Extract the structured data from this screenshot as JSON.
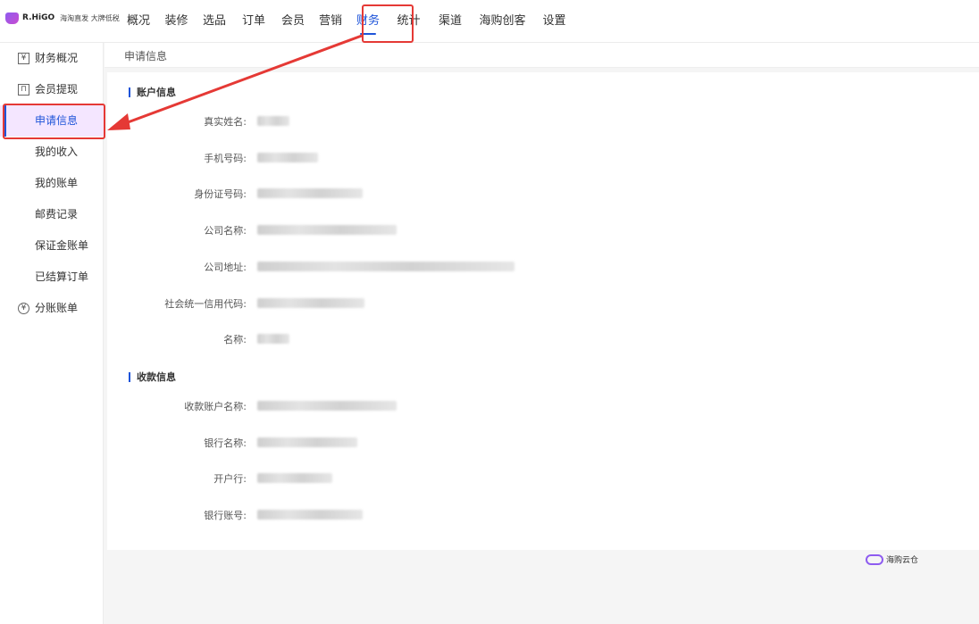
{
  "header": {
    "logo_text": "R.HiGO",
    "logo_subtitle": "海淘直发 大牌低税",
    "nav": [
      "概况",
      "装修",
      "选品",
      "订单",
      "会员",
      "营销",
      "财务",
      "统计",
      "渠道",
      "海购创客",
      "设置"
    ],
    "active_nav": "财务"
  },
  "sidebar": {
    "items": [
      {
        "label": "财务概况",
        "icon": "yen-box-icon",
        "glyph": "¥"
      },
      {
        "label": "会员提现",
        "icon": "wallet-icon",
        "glyph": "⊓"
      },
      {
        "label": "申请信息",
        "active": true
      },
      {
        "label": "我的收入"
      },
      {
        "label": "我的账单"
      },
      {
        "label": "邮费记录"
      },
      {
        "label": "保证金账单"
      },
      {
        "label": "已结算订单"
      },
      {
        "label": "分账账单",
        "icon": "yen-circle-icon",
        "glyph": "¥"
      }
    ]
  },
  "breadcrumb": "申请信息",
  "account_section": {
    "title": "账户信息",
    "rows": [
      {
        "label": "真实姓名:",
        "redacted_width": 36
      },
      {
        "label": "手机号码:",
        "redacted_width": 68
      },
      {
        "label": "身份证号码:",
        "redacted_width": 118
      },
      {
        "label": "公司名称:",
        "redacted_width": 156
      },
      {
        "label": "公司地址:",
        "redacted_width": 288
      },
      {
        "label": "社会统一信用代码:",
        "redacted_width": 120
      },
      {
        "label": "名称:",
        "redacted_width": 36
      }
    ]
  },
  "receiving_section": {
    "title": "收款信息",
    "rows": [
      {
        "label": "收款账户名称:",
        "redacted_width": 156
      },
      {
        "label": "银行名称:",
        "redacted_width": 112
      },
      {
        "label": "开户行:",
        "redacted_width": 84
      },
      {
        "label": "银行账号:",
        "redacted_width": 118
      }
    ]
  },
  "footer": {
    "logo_text": "海购云仓"
  },
  "colors": {
    "accent": "#1e54d9",
    "annotation": "#e53935",
    "active_bg": "#f4e6ff"
  }
}
